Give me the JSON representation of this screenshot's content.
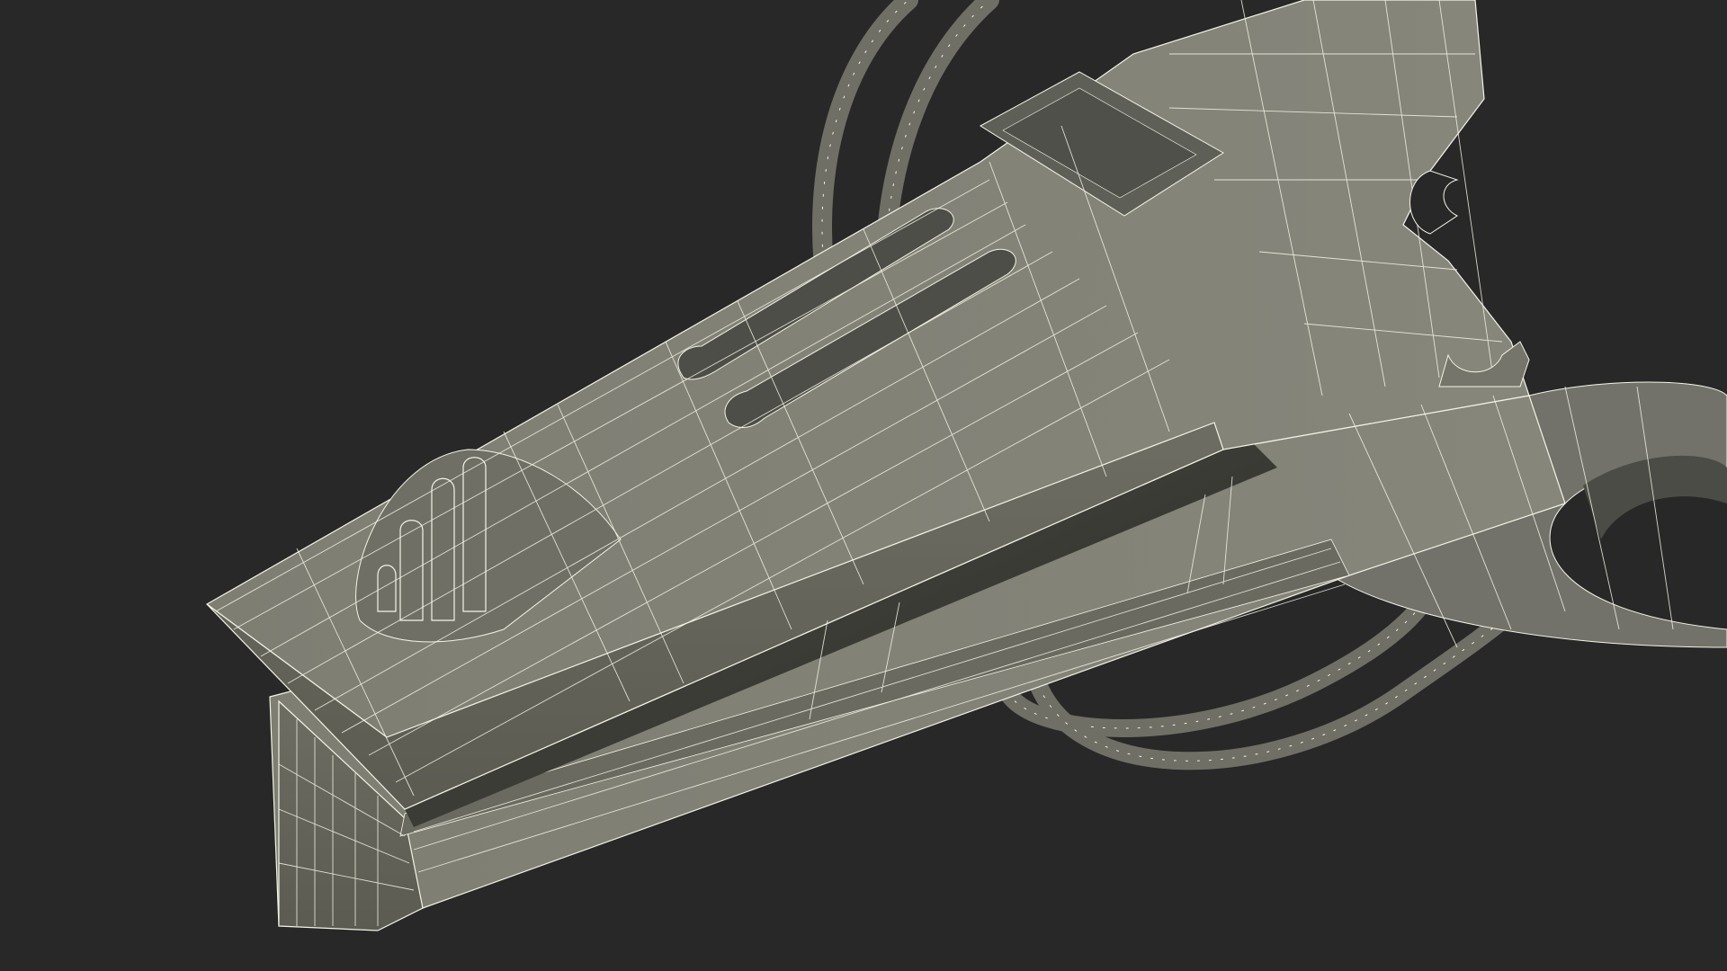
{
  "scene": {
    "subject": "clothespin-clip-wireframe",
    "background_color": "#282828",
    "surface_color": "#7b7b70",
    "surface_shadow_color": "#5d5d54",
    "surface_dark_color": "#3a3b35",
    "wire_color": "#f4f4e6"
  }
}
